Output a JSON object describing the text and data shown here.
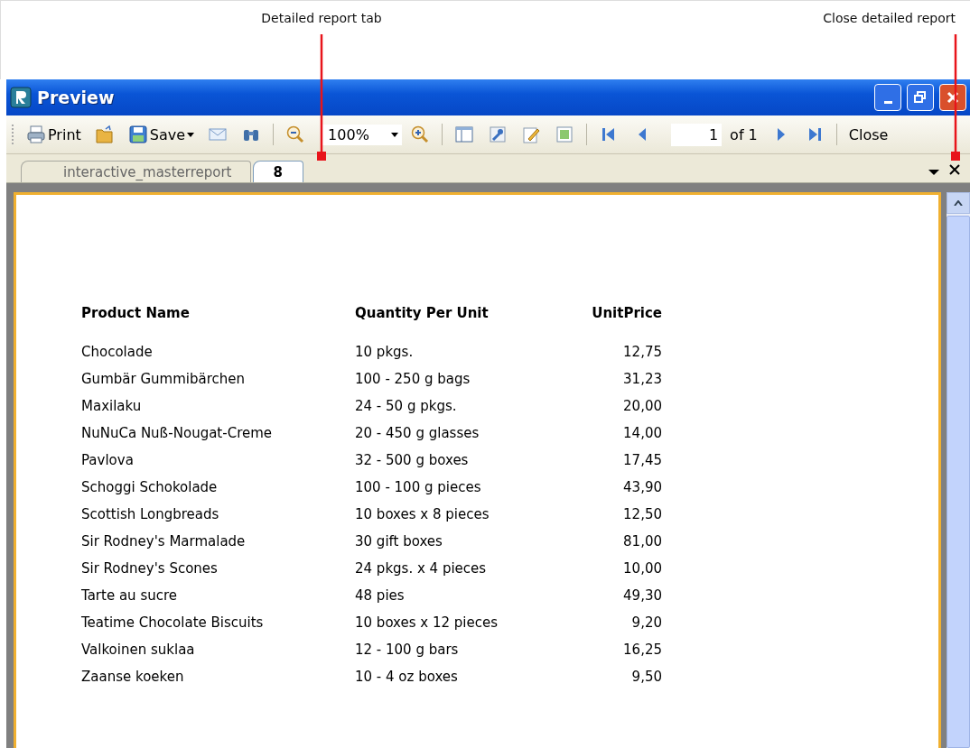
{
  "callouts": [
    {
      "text": "Detailed report tab",
      "kind": "tab"
    },
    {
      "text": "Close detailed report",
      "kind": "close"
    }
  ],
  "window": {
    "title": "Preview"
  },
  "toolbar": [
    {
      "kind": "print",
      "label": "Print"
    },
    {
      "kind": "open"
    },
    {
      "kind": "save",
      "label": "Save"
    },
    {
      "kind": "mail"
    },
    {
      "kind": "find"
    },
    {
      "kind": "sep"
    },
    {
      "kind": "zoom-out"
    },
    {
      "kind": "zoom",
      "value": "100%"
    },
    {
      "kind": "zoom-in"
    },
    {
      "kind": "sep"
    },
    {
      "kind": "layout"
    },
    {
      "kind": "tools"
    },
    {
      "kind": "edit"
    },
    {
      "kind": "image"
    },
    {
      "kind": "sep"
    },
    {
      "kind": "first"
    },
    {
      "kind": "prev"
    },
    {
      "kind": "page",
      "value": "1",
      "label": "of 1"
    },
    {
      "kind": "next"
    },
    {
      "kind": "last"
    },
    {
      "kind": "sep"
    },
    {
      "kind": "close",
      "label": "Close"
    }
  ],
  "tabs": [
    {
      "label": "interactive_masterreport",
      "selected": false
    },
    {
      "label": "8",
      "selected": true
    }
  ],
  "report": {
    "columns": [
      "Product Name",
      "Quantity Per Unit",
      "UnitPrice"
    ],
    "rows": [
      [
        "Chocolade",
        "10 pkgs.",
        "12,75"
      ],
      [
        "Gumbär Gummibärchen",
        "100 - 250 g bags",
        "31,23"
      ],
      [
        "Maxilaku",
        "24 - 50 g pkgs.",
        "20,00"
      ],
      [
        "NuNuCa Nuß-Nougat-Creme",
        "20 - 450 g glasses",
        "14,00"
      ],
      [
        "Pavlova",
        "32 - 500 g boxes",
        "17,45"
      ],
      [
        "Schoggi Schokolade",
        "100 - 100 g pieces",
        "43,90"
      ],
      [
        "Scottish Longbreads",
        "10 boxes x 8 pieces",
        "12,50"
      ],
      [
        "Sir Rodney's Marmalade",
        "30 gift boxes",
        "81,00"
      ],
      [
        "Sir Rodney's Scones",
        "24 pkgs. x 4 pieces",
        "10,00"
      ],
      [
        "Tarte au sucre",
        "48 pies",
        "49,30"
      ],
      [
        "Teatime Chocolate Biscuits",
        "10 boxes x 12 pieces",
        "9,20"
      ],
      [
        "Valkoinen suklaa",
        "12 - 100 g bars",
        "16,25"
      ],
      [
        "Zaanse koeken",
        "10 - 4 oz boxes",
        "9,50"
      ]
    ]
  }
}
